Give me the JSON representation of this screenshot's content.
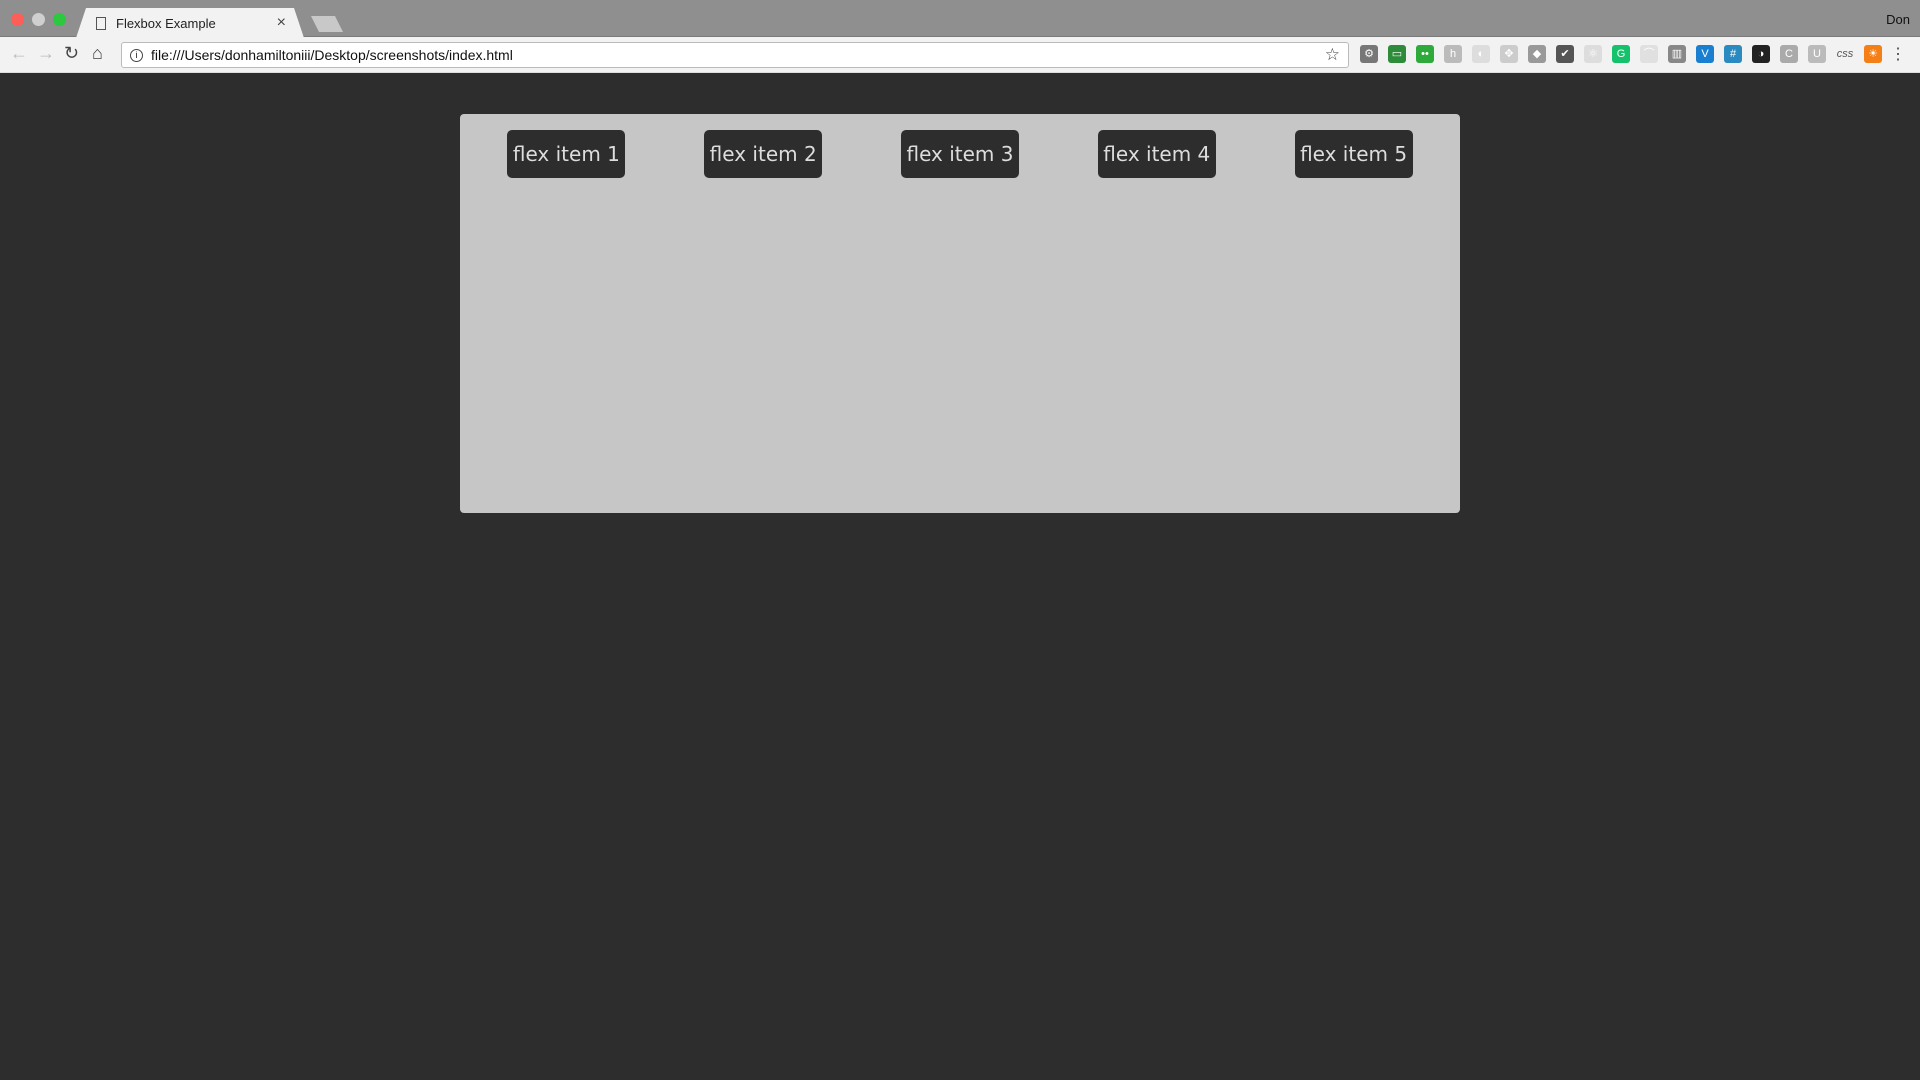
{
  "browser": {
    "tab_title": "Flexbox Example",
    "url": "file:///Users/donhamiltoniii/Desktop/screenshots/index.html",
    "user": "Don",
    "extensions": [
      {
        "icon": "gear-icon",
        "color": "#777777",
        "glyph": "⚙"
      },
      {
        "icon": "screenshot-icon",
        "color": "#2e8b3a",
        "glyph": "▭"
      },
      {
        "icon": "robot-icon",
        "color": "#2eaa3a",
        "glyph": "••"
      },
      {
        "icon": "h-icon",
        "color": "#bbbbbb",
        "glyph": "h"
      },
      {
        "icon": "swirl-icon",
        "color": "#dddddd",
        "glyph": "◐"
      },
      {
        "icon": "dropbox-icon",
        "color": "#cccccc",
        "glyph": "✥"
      },
      {
        "icon": "layers-icon",
        "color": "#999999",
        "glyph": "◆"
      },
      {
        "icon": "pocket-icon",
        "color": "#555555",
        "glyph": "✔"
      },
      {
        "icon": "react-icon",
        "color": "#dddddd",
        "glyph": "⚛"
      },
      {
        "icon": "grammarly-icon",
        "color": "#15c26b",
        "glyph": "G"
      },
      {
        "icon": "rainbow-icon",
        "color": "#e0e0e0",
        "glyph": "⌒"
      },
      {
        "icon": "book-icon",
        "color": "#888888",
        "glyph": "▥"
      },
      {
        "icon": "vue-icon",
        "color": "#1a7fd0",
        "glyph": "V"
      },
      {
        "icon": "grid-icon",
        "color": "#2b8ac0",
        "glyph": "#"
      },
      {
        "icon": "contrast-icon",
        "color": "#222222",
        "glyph": "◑"
      },
      {
        "icon": "c-icon",
        "color": "#aaaaaa",
        "glyph": "C"
      },
      {
        "icon": "u-icon",
        "color": "#bbbbbb",
        "glyph": "U"
      },
      {
        "icon": "css-icon",
        "color": "#f2f2f2",
        "glyph": "css"
      },
      {
        "icon": "hubspot-icon",
        "color": "#f57f17",
        "glyph": "☀"
      }
    ]
  },
  "page": {
    "items": [
      "flex item 1",
      "flex item 2",
      "flex item 3",
      "flex item 4",
      "flex item 5"
    ]
  }
}
